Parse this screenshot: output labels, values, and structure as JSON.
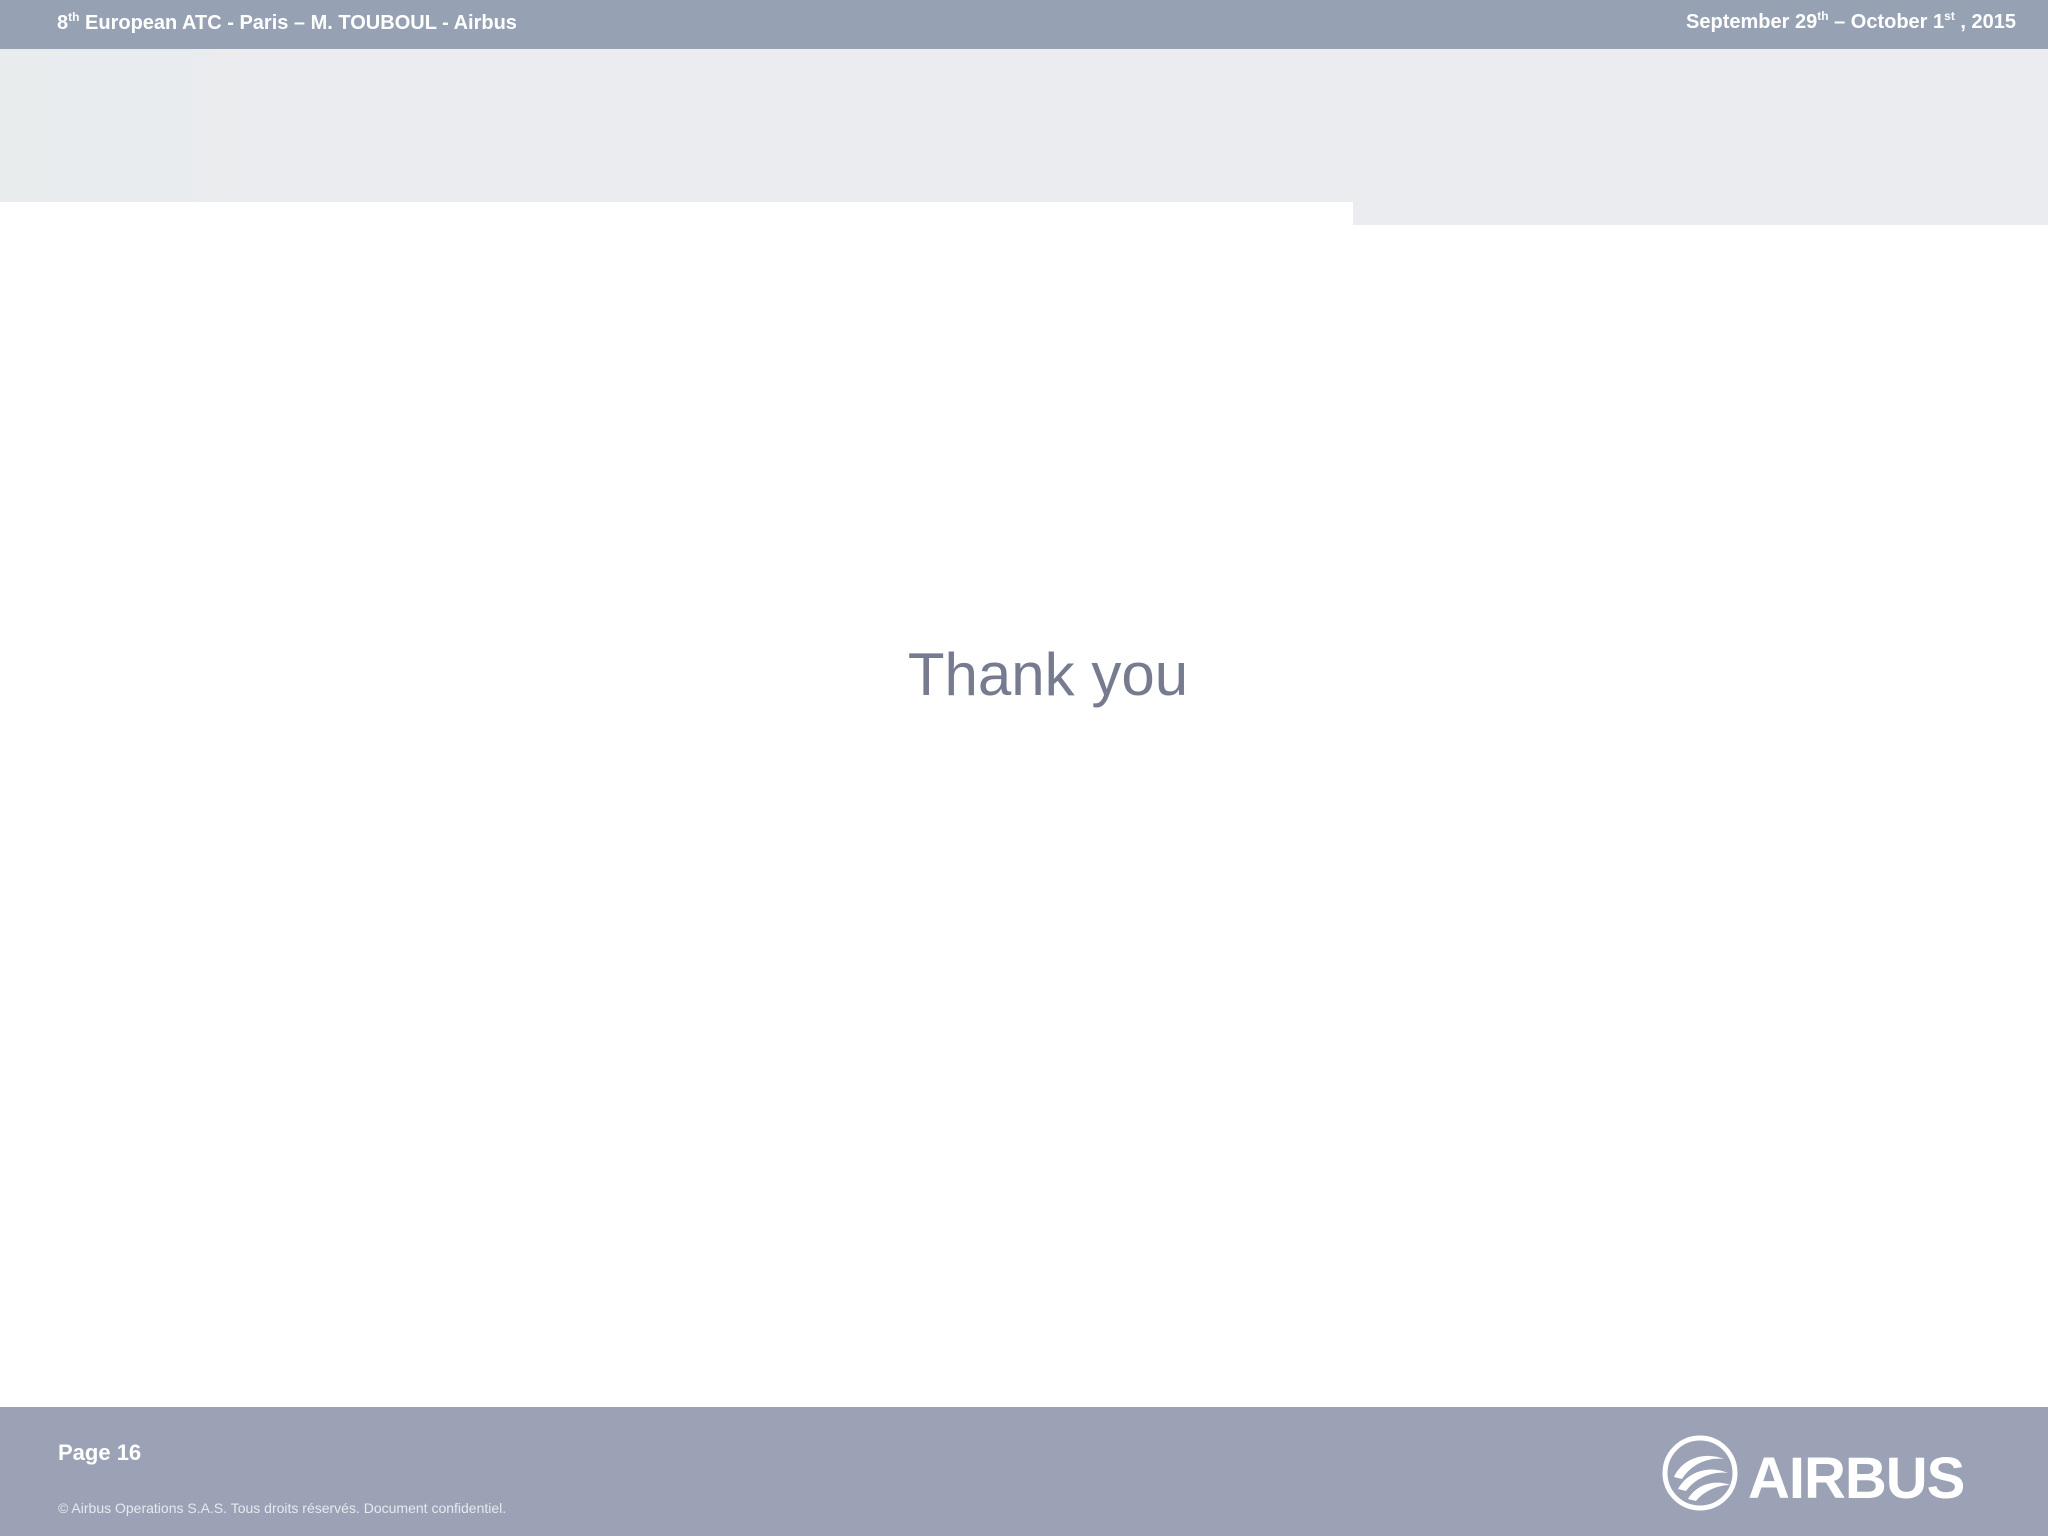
{
  "header": {
    "event_prefix": "8",
    "event_ordinal": "th",
    "event_rest": " European ATC - Paris – M. TOUBOUL - Airbus",
    "date_start": "September 29",
    "date_start_ordinal": "th",
    "date_sep": " – October 1",
    "date_end_ordinal": "st",
    "date_year": " , 2015"
  },
  "main": {
    "message": "Thank you"
  },
  "footer": {
    "page_label": "Page 16",
    "copyright": "© Airbus Operations S.A.S. Tous droits réservés. Document confidentiel.",
    "logo": {
      "icon": "airbus-logo-icon",
      "word": "AIRBUS"
    }
  },
  "colors": {
    "header_bar": "#96a1b4",
    "footer_bar": "#9ba2b5",
    "band": "#ebecef",
    "message_text": "#777b8f",
    "header_text": "#ffffff"
  }
}
